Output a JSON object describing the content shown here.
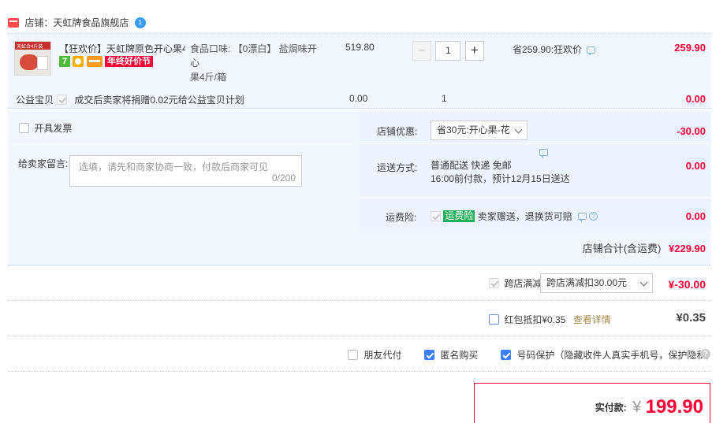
{
  "shop": {
    "label": "店铺：天虹牌食品旗舰店",
    "badge_text": "1"
  },
  "item": {
    "title": "【狂欢价】天虹牌原色开心果4...",
    "promo_tag": "年终好价节",
    "thumb_text": "天虹合4斤装",
    "sku_line1": "食品口味: 【0漂白】 盐焗味开心",
    "sku_line2": "果4斤/箱",
    "unit_price": "519.80",
    "qty": "1",
    "qty_minus": "−",
    "qty_plus": "+",
    "discount": "省259.90:狂欢价",
    "total": "259.90"
  },
  "charity": {
    "label": "公益宝贝",
    "desc": "成交后卖家将捐赠0.02元给公益宝贝计划",
    "price": "0.00",
    "qty": "1",
    "total": "0.00"
  },
  "invoice": {
    "label": "开具发票"
  },
  "message": {
    "label": "给卖家留言:",
    "placeholder": "选填，请先和商家协商一致，付款后商家可见",
    "counter": "0/200"
  },
  "shop_discount": {
    "label": "店铺优惠:",
    "selected": "省30元:开心果-花",
    "amount": "-30.00"
  },
  "shipping": {
    "label": "运送方式:",
    "line1": "普通配送 快递 免邮",
    "line2": "16:00前付款，预计12月15日送达",
    "amount": "0.00"
  },
  "insurance": {
    "label": "运费险:",
    "tag": "运费险",
    "desc": "卖家赠送，退换货可赔",
    "amount": "0.00"
  },
  "shop_total": {
    "label": "店铺合计(含运费)",
    "amount": "¥229.90"
  },
  "cross_store": {
    "label": "跨店满减",
    "selected": "跨店满减扣30.00元",
    "amount": "¥-30.00"
  },
  "red_packet": {
    "label": "红包抵扣¥0.35",
    "link": "查看详情",
    "amount": "¥0.35"
  },
  "options": {
    "friend_pay": "朋友代付",
    "anonymous": "匿名购买",
    "privacy": "号码保护（隐藏收件人真实手机号，保护隐私）",
    "help": "?"
  },
  "payment": {
    "label": "实付款:",
    "currency": "¥",
    "amount": "199.90"
  },
  "colors": {
    "accent_red": "#ff0036",
    "panel_bg": "#f2f7ff",
    "checkbox_blue": "#3d7eff"
  }
}
